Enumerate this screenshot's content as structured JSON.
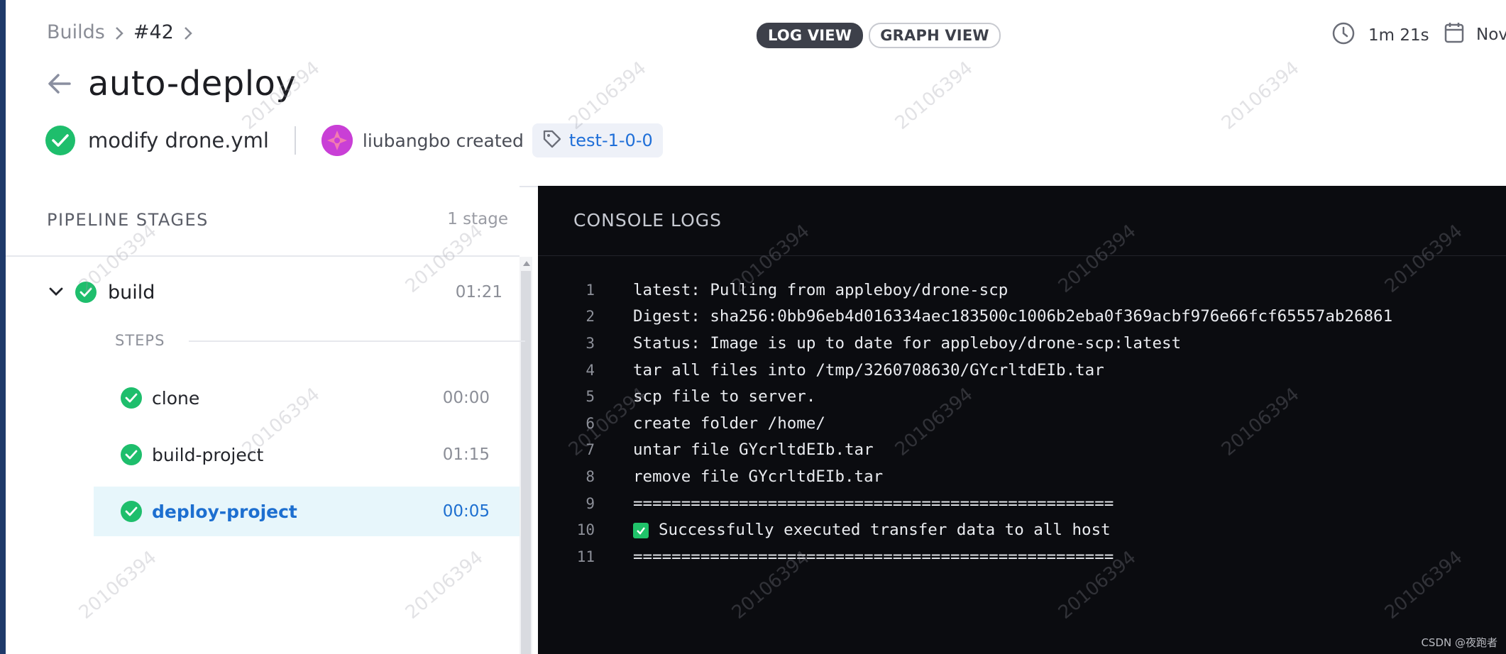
{
  "breadcrumb": {
    "builds": "Builds",
    "build_number": "#42"
  },
  "view_toggle": {
    "log_view": "LOG VIEW",
    "graph_view": "GRAPH VIEW"
  },
  "duration": "1m 21s",
  "date": "Nov",
  "title": "auto-deploy",
  "commit_message": "modify drone.yml",
  "creator": "liubangbo created",
  "tag": "test-1-0-0",
  "sidebar": {
    "heading": "PIPELINE STAGES",
    "count": "1 stage",
    "stage": {
      "name": "build",
      "time": "01:21"
    },
    "steps_label": "STEPS",
    "steps": [
      {
        "name": "clone",
        "time": "00:00"
      },
      {
        "name": "build-project",
        "time": "01:15"
      },
      {
        "name": "deploy-project",
        "time": "00:05"
      }
    ]
  },
  "console": {
    "heading": "CONSOLE LOGS",
    "lines": [
      {
        "n": "1",
        "text": "latest: Pulling from appleboy/drone-scp"
      },
      {
        "n": "2",
        "text": "Digest: sha256:0bb96eb4d016334aec183500c1006b2eba0f369acbf976e66fcf65557ab26861"
      },
      {
        "n": "3",
        "text": "Status: Image is up to date for appleboy/drone-scp:latest"
      },
      {
        "n": "4",
        "text": "tar all files into /tmp/3260708630/GYcrltdEIb.tar"
      },
      {
        "n": "5",
        "text": "scp file to server."
      },
      {
        "n": "6",
        "text": "create folder /home/"
      },
      {
        "n": "7",
        "text": "untar file GYcrltdEIb.tar"
      },
      {
        "n": "8",
        "text": "remove file GYcrltdEIb.tar"
      },
      {
        "n": "9",
        "text": "=================================================="
      },
      {
        "n": "10",
        "text": "Successfully executed transfer data to all host"
      },
      {
        "n": "11",
        "text": "=================================================="
      }
    ]
  },
  "watermark": "20106394",
  "footer": "CSDN @夜跑者",
  "colors": {
    "success": "#1ebe6c",
    "link": "#1d6fd0",
    "console_bg": "#0b0c10",
    "selected_bg": "#e7f6fb"
  }
}
